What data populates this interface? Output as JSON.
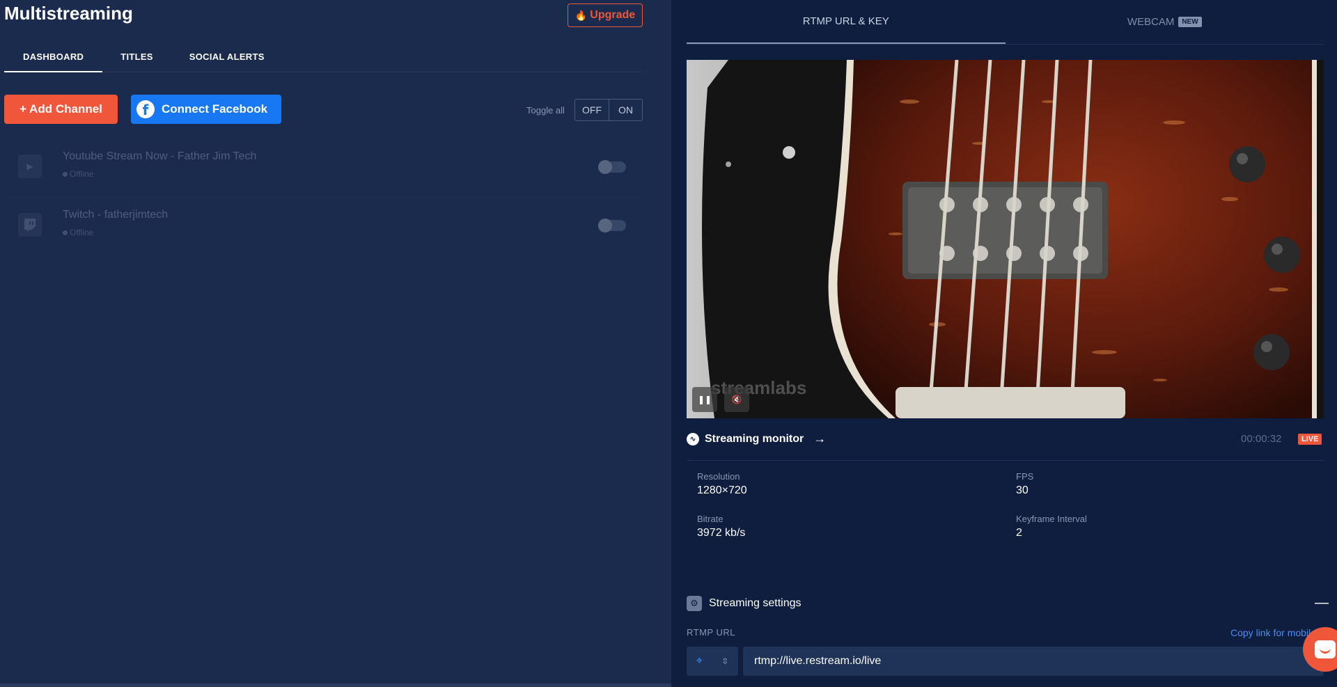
{
  "app": {
    "title": "Multistreaming",
    "upgrade_label": "Upgrade"
  },
  "tabs": [
    {
      "label": "DASHBOARD",
      "active": true
    },
    {
      "label": "TITLES",
      "active": false
    },
    {
      "label": "SOCIAL ALERTS",
      "active": false
    }
  ],
  "actions": {
    "add_channel_label": "Add Channel",
    "connect_facebook_label": "Connect Facebook",
    "toggle_all_label": "Toggle all",
    "off_label": "OFF",
    "on_label": "ON"
  },
  "channels": [
    {
      "name": "Youtube Stream Now - Father Jim Tech",
      "status": "Offline",
      "icon": "play-icon",
      "enabled": false
    },
    {
      "name": "Twitch - fatherjimtech",
      "status": "Offline",
      "icon": "twitch-icon",
      "enabled": false
    }
  ],
  "right_tabs": [
    {
      "label": "RTMP URL & KEY",
      "active": true
    },
    {
      "label": "WEBCAM",
      "badge": "NEW",
      "active": false
    }
  ],
  "video": {
    "watermark": "streamlabs"
  },
  "monitor": {
    "title": "Streaming monitor",
    "timer": "00:00:32",
    "live_badge": "LIVE",
    "stats": {
      "resolution_label": "Resolution",
      "resolution_value": "1280×720",
      "fps_label": "FPS",
      "fps_value": "30",
      "bitrate_label": "Bitrate",
      "bitrate_value": "3972 kb/s",
      "keyframe_label": "Keyframe Interval",
      "keyframe_value": "2"
    }
  },
  "settings": {
    "title": "Streaming settings",
    "rtmp_url_label": "RTMP URL",
    "copy_link_label": "Copy link for mobile",
    "rtmp_url_value": "rtmp://live.restream.io/live"
  },
  "colors": {
    "accent": "#f0563a",
    "facebook": "#1877f2",
    "link": "#4a8cf0",
    "left_bg": "#1b2b4d",
    "right_bg": "#0f1e3f"
  }
}
